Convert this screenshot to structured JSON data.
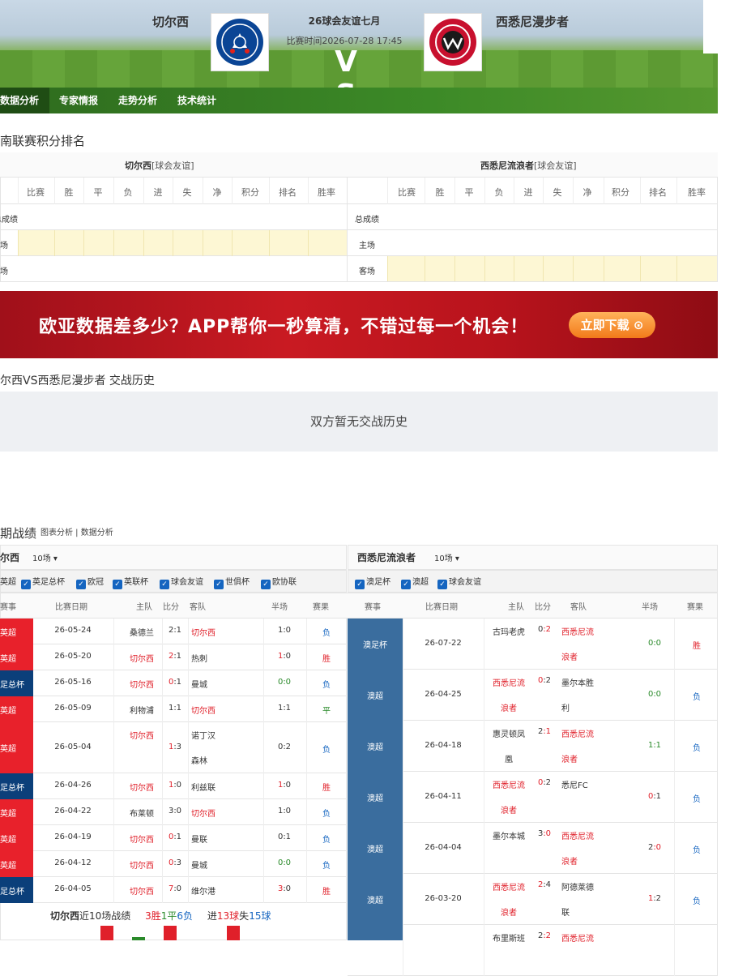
{
  "header": {
    "home_team": "切尔西",
    "away_team": "西悉尼漫步者",
    "competition": "26球会友谊七月",
    "match_time": "比赛时间2026-07-28 17:45",
    "vs": "V S"
  },
  "nav": [
    {
      "label": "数据分析"
    },
    {
      "label": "专家情报"
    },
    {
      "label": "走势分析"
    },
    {
      "label": "技术统计"
    }
  ],
  "standings": {
    "title": "南联赛积分排名",
    "home_label": "切尔西",
    "home_sub": "[球会友谊]",
    "away_label": "西悉尼流浪者",
    "away_sub": "[球会友谊]",
    "columns": [
      "比赛",
      "胜",
      "平",
      "负",
      "进",
      "失",
      "净",
      "积分",
      "排名",
      "胜率"
    ],
    "home_rows": [
      "总成绩",
      "主场",
      "客场"
    ],
    "away_rows": [
      "总成绩",
      "主场",
      "客场"
    ]
  },
  "ad": {
    "text": "欧亚数据差多少？APP帮你一秒算清，不错过每一个机会！",
    "button": "立即下载 ⊙"
  },
  "h2h": {
    "title": "尔西VS西悉尼漫步者 交战历史",
    "empty": "双方暂无交战历史"
  },
  "recent": {
    "title": "期战绩",
    "links": "图表分析 | 数据分析",
    "home_team": "尔西",
    "away_team": "西悉尼流浪者",
    "count": "10场",
    "home_filters": [
      "英超",
      "英足总杯",
      "欧冠",
      "英联杯",
      "球会友谊",
      "世俱杯",
      "欧协联"
    ],
    "away_filters": [
      "澳足杯",
      "澳超",
      "球会友谊"
    ],
    "columns": [
      "赛事",
      "比赛日期",
      "主队",
      "比分",
      "客队",
      "半场",
      "赛果"
    ],
    "home_matches": [
      {
        "league": "英超",
        "date": "26-05-24",
        "home": "桑德兰",
        "s1": "2",
        "s2": "1",
        "away": "切尔西",
        "half": "1:0",
        "result": "负",
        "away_red": true
      },
      {
        "league": "英超",
        "date": "26-05-20",
        "home": "切尔西",
        "s1": "2",
        "s2": "1",
        "away": "热刺",
        "half": "1:0",
        "result": "胜",
        "home_red": true
      },
      {
        "league": "足总杯",
        "date": "26-05-16",
        "home": "切尔西",
        "s1": "0",
        "s2": "1",
        "away": "曼城",
        "half": "0:0",
        "result": "负",
        "home_red": true
      },
      {
        "league": "英超",
        "date": "26-05-09",
        "home": "利物浦",
        "s1": "1",
        "s2": "1",
        "away": "切尔西",
        "half": "1:1",
        "result": "平",
        "away_red": true
      },
      {
        "league": "英超",
        "date": "26-05-04",
        "home": "切尔西",
        "s1": "1",
        "s2": "3",
        "away": "诺丁汉森林",
        "half": "0:2",
        "result": "负",
        "home_red": true,
        "tall": true
      },
      {
        "league": "足总杯",
        "date": "26-04-26",
        "home": "切尔西",
        "s1": "1",
        "s2": "0",
        "away": "利兹联",
        "half": "1:0",
        "result": "胜",
        "home_red": true
      },
      {
        "league": "英超",
        "date": "26-04-22",
        "home": "布莱顿",
        "s1": "3",
        "s2": "0",
        "away": "切尔西",
        "half": "1:0",
        "result": "负",
        "away_red": true
      },
      {
        "league": "英超",
        "date": "26-04-19",
        "home": "切尔西",
        "s1": "0",
        "s2": "1",
        "away": "曼联",
        "half": "0:1",
        "result": "负",
        "home_red": true
      },
      {
        "league": "英超",
        "date": "26-04-12",
        "home": "切尔西",
        "s1": "0",
        "s2": "3",
        "away": "曼城",
        "half": "0:0",
        "result": "负",
        "home_red": true
      },
      {
        "league": "足总杯",
        "date": "26-04-05",
        "home": "切尔西",
        "s1": "7",
        "s2": "0",
        "away": "维尔港",
        "half": "3:0",
        "result": "胜",
        "home_red": true
      }
    ],
    "home_summary": {
      "team": "切尔西",
      "text": "近10场战绩",
      "w": "3胜",
      "d": "1平",
      "l": "6负",
      "goals": "进",
      "gf": "13球",
      "lost": "失",
      "ga": "15球"
    },
    "away_matches": [
      {
        "league": "澳足杯",
        "date": "26-07-22",
        "home": "古玛老虎",
        "s1": "0",
        "s2": "2",
        "away": "西悉尼流浪者",
        "half": "0:0",
        "result": "胜",
        "away_red": true
      },
      {
        "league": "澳超",
        "date": "26-04-25",
        "home": "西悉尼流浪者",
        "s1": "0",
        "s2": "2",
        "away": "墨尔本胜利",
        "half": "0:0",
        "result": "负",
        "home_red": true
      },
      {
        "league": "澳超",
        "date": "26-04-18",
        "home": "惠灵顿凤凰",
        "s1": "2",
        "s2": "1",
        "away": "西悉尼流浪者",
        "half": "1:1",
        "result": "负",
        "away_red": true
      },
      {
        "league": "澳超",
        "date": "26-04-11",
        "home": "西悉尼流浪者",
        "s1": "0",
        "s2": "2",
        "away": "悉尼FC",
        "half": "0:1",
        "result": "负",
        "home_red": true
      },
      {
        "league": "澳超",
        "date": "26-04-04",
        "home": "墨尔本城",
        "s1": "3",
        "s2": "0",
        "away": "西悉尼流浪者",
        "half": "2:0",
        "result": "负",
        "away_red": true
      },
      {
        "league": "澳超",
        "date": "26-03-20",
        "home": "西悉尼流浪者",
        "s1": "2",
        "s2": "4",
        "away": "阿德莱德联",
        "half": "1:2",
        "result": "负",
        "home_red": true
      },
      {
        "league": "",
        "date": "",
        "home": "布里斯班",
        "s1": "2",
        "s2": "2",
        "away": "西悉尼流",
        "half": "",
        "result": "",
        "away_red": true
      }
    ]
  },
  "colors": {
    "epl": "#e8212b",
    "fa": "#0b3f7a",
    "aus": "#3a6d9e",
    "nav": "#2e6b1e"
  }
}
